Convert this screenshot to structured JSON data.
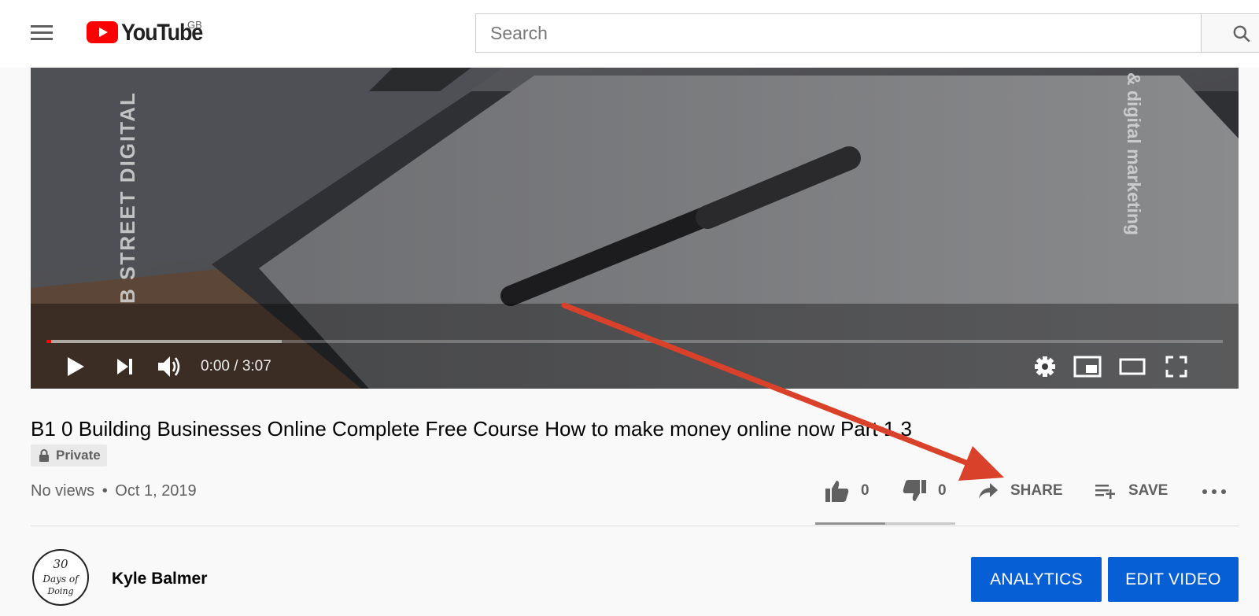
{
  "header": {
    "logo_text": "YouTube",
    "region": "GB",
    "search_placeholder": "Search",
    "icons": {
      "menu": "hamburger-menu-icon",
      "search": "search-icon"
    }
  },
  "player": {
    "overlay_left": "B STREET DIGITAL",
    "overlay_right": "& digital marketing",
    "time_display": "0:00 / 3:07",
    "progress_played": 0.0,
    "progress_buffered": 0.2,
    "icons": [
      "play-icon",
      "next-icon",
      "volume-icon",
      "settings-gear-icon",
      "miniplayer-icon",
      "theater-mode-icon",
      "fullscreen-icon"
    ]
  },
  "video": {
    "title": "B1 0 Building Businesses Online Complete Free Course How to make money online now Part 1 3",
    "privacy": "Private",
    "views": "No views",
    "separator": "•",
    "date": "Oct 1, 2019"
  },
  "actions": {
    "likes": "0",
    "dislikes": "0",
    "share_label": "SHARE",
    "save_label": "SAVE",
    "like_ratio": 0.5
  },
  "channel": {
    "name": "Kyle Balmer",
    "avatar_lines": [
      "30",
      "Days of",
      "Doing"
    ]
  },
  "buttons": {
    "analytics": "ANALYTICS",
    "edit_video": "EDIT VIDEO"
  },
  "colors": {
    "brand_red": "#ff0000",
    "button_blue": "#065fd4",
    "annotation_arrow": "#d9412a"
  }
}
